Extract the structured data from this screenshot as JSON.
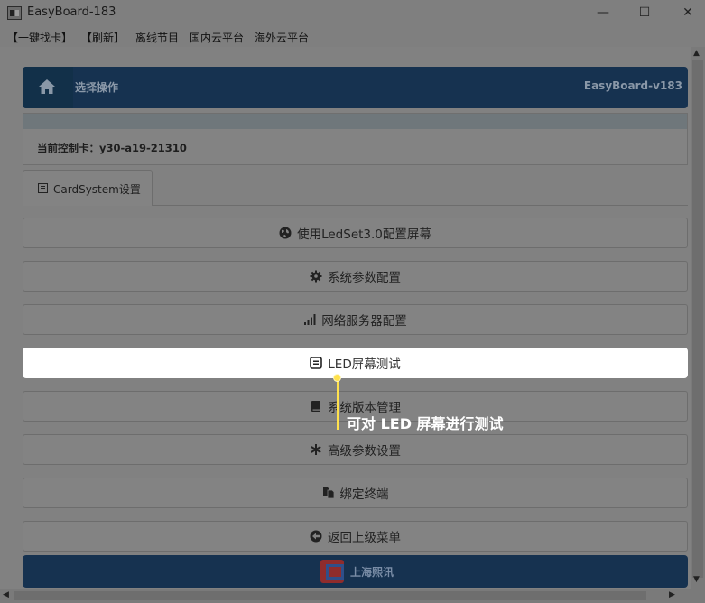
{
  "window": {
    "title": "EasyBoard-183",
    "minimize": "—",
    "maximize": "☐",
    "close": "✕"
  },
  "menubar": [
    {
      "label": "【一键找卡】"
    },
    {
      "label": "【刷新】"
    },
    {
      "label": "离线节目"
    },
    {
      "label": "国内云平台"
    },
    {
      "label": "海外云平台"
    }
  ],
  "header": {
    "title": "选择操作",
    "version": "EasyBoard-v183"
  },
  "info": {
    "current_card": "当前控制卡：y30-a19-21310"
  },
  "tab": {
    "label": "CardSystem设置"
  },
  "menu": [
    {
      "label": "使用LedSet3.0配置屏幕",
      "icon": "globe-icon"
    },
    {
      "label": "系统参数配置",
      "icon": "gear-icon"
    },
    {
      "label": "网络服务器配置",
      "icon": "signal-bars-icon"
    },
    {
      "label": "LED屏幕测试",
      "icon": "screen-icon"
    },
    {
      "label": "系统版本管理",
      "icon": "book-icon"
    },
    {
      "label": "高级参数设置",
      "icon": "asterisk-icon"
    },
    {
      "label": "绑定终端",
      "icon": "documents-icon"
    },
    {
      "label": "返回上级菜单",
      "icon": "back-arrow-icon"
    }
  ],
  "callout": {
    "text": "可对 LED 屏幕进行测试"
  },
  "footer": {
    "brand": "上海熙讯"
  },
  "colors": {
    "header_bg": "#163250",
    "highlight": "#ffffff",
    "callout": "#ffe14d"
  }
}
